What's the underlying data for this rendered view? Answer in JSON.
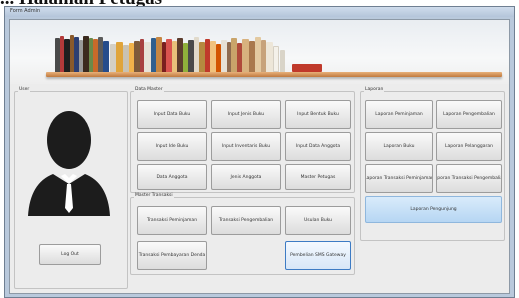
{
  "heading": "... Halaman Petugas",
  "window": {
    "title": "Form Admin"
  },
  "user_panel": {
    "label": "User",
    "logout_label": "Log Out"
  },
  "data_master": {
    "label": "Data Master",
    "buttons": [
      "Input Data Buku",
      "Input Jenis Buku",
      "Input Bentuk Buku",
      "Input Ide Buku",
      "Input Inventaris Buku",
      "Input Data Anggota",
      "Data Anggota",
      "Jenis Anggota",
      "Master Petugas"
    ]
  },
  "transaksi": {
    "label": "Master Transaksi",
    "buttons": [
      "Transaksi Peminjaman",
      "Transaksi Pengembalian",
      "Usulan Buku",
      "Transaksi Pembayaran Denda",
      "Pembelian SMS Gateway"
    ]
  },
  "laporan": {
    "label": "Laporan",
    "buttons": [
      "Laporan Peminjaman",
      "Laporan Pengembalian",
      "Laporan Buku",
      "Laporan Pelanggaran",
      "Laporan Transaksi Peminjaman",
      "Laporan Transaksi Pengembalian",
      "Laporan Pengunjung"
    ]
  }
}
